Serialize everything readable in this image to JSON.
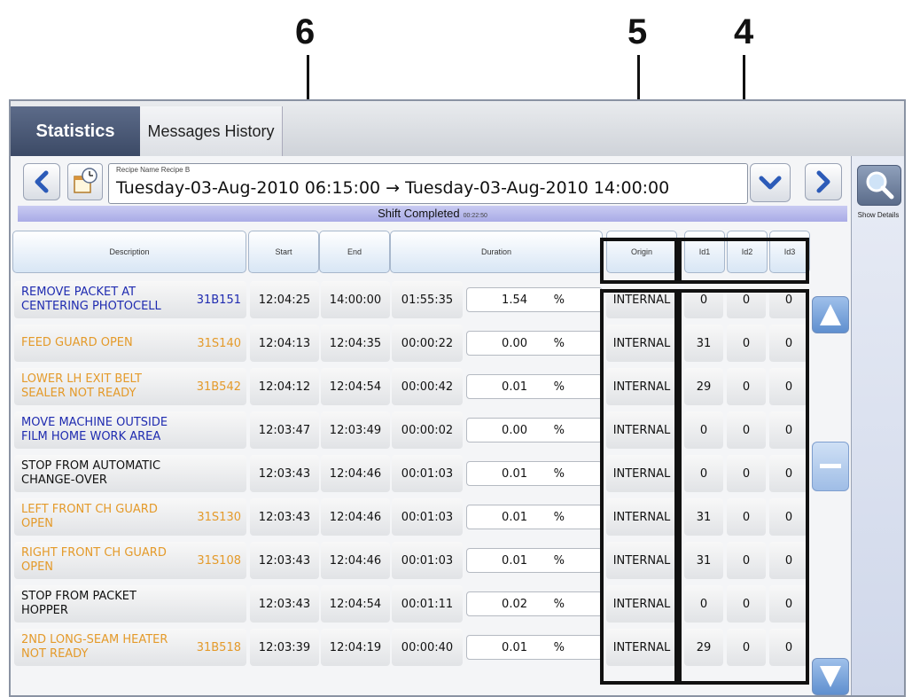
{
  "callouts": {
    "c6": "6",
    "c5": "5",
    "c4": "4"
  },
  "tabs": {
    "statistics": "Statistics",
    "messages_history": "Messages History"
  },
  "recipe": {
    "label": "Recipe Name   Recipe B",
    "range": "Tuesday-03-Aug-2010 06:15:00 → Tuesday-03-Aug-2010 14:00:00"
  },
  "shift": {
    "status": "Shift Completed",
    "duration": "00:22:50"
  },
  "columns": {
    "description": "Description",
    "start": "Start",
    "end": "End",
    "duration": "Duration",
    "origin": "Origin",
    "id1": "Id1",
    "id2": "Id2",
    "id3": "Id3"
  },
  "percent_sign": "%",
  "right_panel": {
    "show_details": "Show Details"
  },
  "colors": {
    "blue_text": "#1f2bb0",
    "orange_text": "#e49a2a",
    "tab_active": "#3c4a66"
  },
  "rows": [
    {
      "desc": "REMOVE PACKET AT CENTERING PHOTOCELL",
      "code": "31B151",
      "color": "blue",
      "start": "12:04:25",
      "end": "14:00:00",
      "duration": "01:55:35",
      "pct": "1.54",
      "origin": "INTERNAL",
      "id1": "0",
      "id2": "0",
      "id3": "0"
    },
    {
      "desc": "FEED GUARD OPEN",
      "code": "31S140",
      "color": "orange",
      "start": "12:04:13",
      "end": "12:04:35",
      "duration": "00:00:22",
      "pct": "0.00",
      "origin": "INTERNAL",
      "id1": "31",
      "id2": "0",
      "id3": "0"
    },
    {
      "desc": "LOWER LH EXIT BELT SEALER NOT READY",
      "code": "31B542",
      "color": "orange",
      "start": "12:04:12",
      "end": "12:04:54",
      "duration": "00:00:42",
      "pct": "0.01",
      "origin": "INTERNAL",
      "id1": "29",
      "id2": "0",
      "id3": "0"
    },
    {
      "desc": "MOVE MACHINE OUTSIDE FILM HOME WORK AREA",
      "code": "",
      "color": "blue",
      "start": "12:03:47",
      "end": "12:03:49",
      "duration": "00:00:02",
      "pct": "0.00",
      "origin": "INTERNAL",
      "id1": "0",
      "id2": "0",
      "id3": "0"
    },
    {
      "desc": "STOP FROM AUTOMATIC CHANGE-OVER",
      "code": "",
      "color": "black",
      "start": "12:03:43",
      "end": "12:04:46",
      "duration": "00:01:03",
      "pct": "0.01",
      "origin": "INTERNAL",
      "id1": "0",
      "id2": "0",
      "id3": "0"
    },
    {
      "desc": "LEFT FRONT CH GUARD OPEN",
      "code": "31S130",
      "color": "orange",
      "start": "12:03:43",
      "end": "12:04:46",
      "duration": "00:01:03",
      "pct": "0.01",
      "origin": "INTERNAL",
      "id1": "31",
      "id2": "0",
      "id3": "0"
    },
    {
      "desc": "RIGHT FRONT CH GUARD OPEN",
      "code": "31S108",
      "color": "orange",
      "start": "12:03:43",
      "end": "12:04:46",
      "duration": "00:01:03",
      "pct": "0.01",
      "origin": "INTERNAL",
      "id1": "31",
      "id2": "0",
      "id3": "0"
    },
    {
      "desc": "STOP FROM PACKET HOPPER",
      "code": "",
      "color": "black",
      "start": "12:03:43",
      "end": "12:04:54",
      "duration": "00:01:11",
      "pct": "0.02",
      "origin": "INTERNAL",
      "id1": "0",
      "id2": "0",
      "id3": "0"
    },
    {
      "desc": "2ND LONG-SEAM HEATER NOT READY",
      "code": "31B518",
      "color": "orange",
      "start": "12:03:39",
      "end": "12:04:19",
      "duration": "00:00:40",
      "pct": "0.01",
      "origin": "INTERNAL",
      "id1": "29",
      "id2": "0",
      "id3": "0"
    }
  ]
}
